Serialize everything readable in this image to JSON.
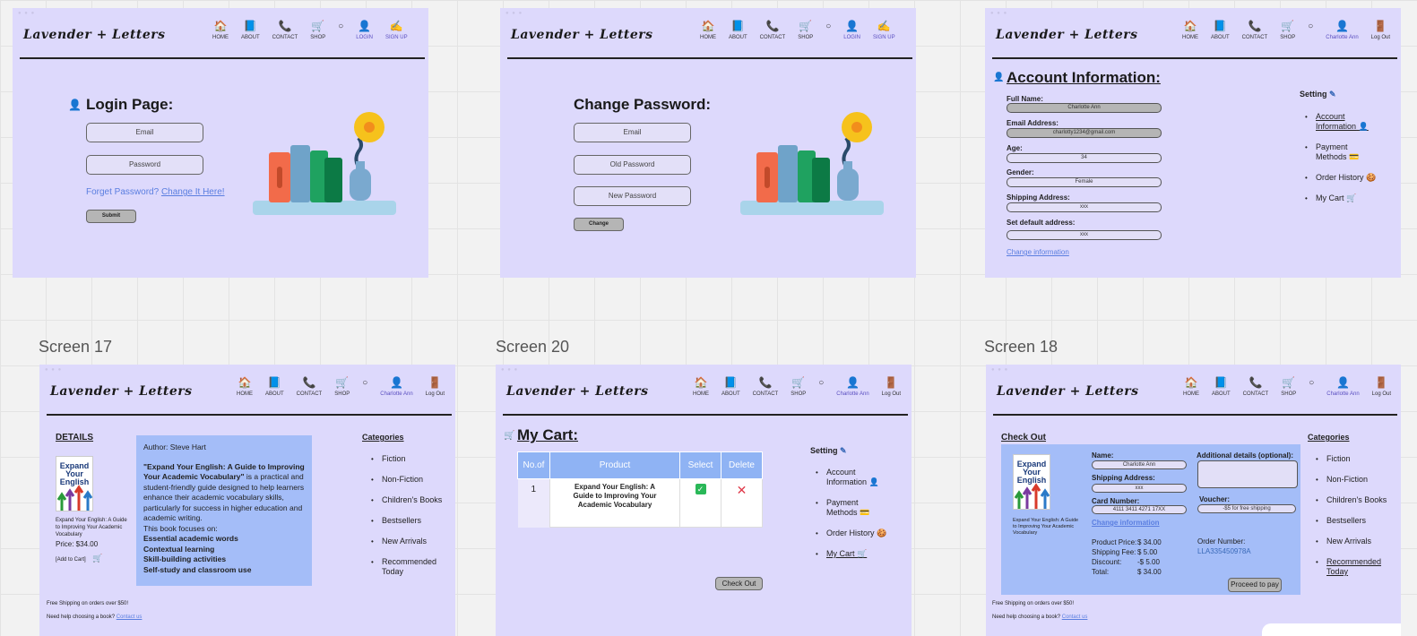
{
  "brand": "Lavender + Letters",
  "nav": {
    "home": "HOME",
    "about": "ABOUT",
    "contact": "CONTACT",
    "shop": "SHOP",
    "login": "LOGIN",
    "signup": "SIGN UP",
    "user": "Charlotte Ann",
    "logout": "Log Out"
  },
  "screen_labels": {
    "s17": "Screen 17",
    "s20": "Screen 20",
    "s18": "Screen 18"
  },
  "login": {
    "title": "Login Page:",
    "email": "Email",
    "password": "Password",
    "forget": "Forget Password?",
    "change_it": "Change It Here!",
    "submit": "Submit"
  },
  "change_pw": {
    "title": "Change Password:",
    "email": "Email",
    "old": "Old Password",
    "new": "New Password",
    "button": "Change"
  },
  "account": {
    "title": "Account Information:",
    "full_name_label": "Full Name:",
    "full_name": "Charlotte Ann",
    "email_label": "Email Address:",
    "email": "charlotty1234@gmail.com",
    "age_label": "Age:",
    "age": "34",
    "gender_label": "Gender:",
    "gender": "Female",
    "ship_label": "Shipping Address:",
    "ship": "xxx",
    "default_label": "Set default address:",
    "default": "xxx",
    "change_info": "Change information"
  },
  "settings": {
    "title": "Setting",
    "items": [
      "Account Information",
      "Payment Methods",
      "Order History",
      "My Cart"
    ]
  },
  "details": {
    "heading": "DETAILS",
    "author": "Author: Steve Hart",
    "desc_bold": "\"Expand Your English: A Guide to Improving Your Academic Vocabulary\"",
    "desc_rest": " is a practical and student-friendly guide designed to help learners enhance their academic vocabulary skills, particularly for success in higher education and academic writing.",
    "focus": "This book focuses on:",
    "points": [
      "Essential academic words",
      "Contextual learning",
      "Skill-building activities",
      "Self-study and classroom use"
    ],
    "book_name": "Expand Your English: A Guide to Improving Your Academic Vocabulary",
    "price": "Price: $34.00",
    "add": "[Add to Cart]",
    "cover_title": "Expand Your English",
    "shipping_note": "Free Shipping on orders over $50!",
    "help": "Need help choosing a book?",
    "contact": "Contact us"
  },
  "categories": {
    "title": "Categories",
    "items": [
      "Fiction",
      "Non-Fiction",
      "Children's Books",
      "Bestsellers",
      "New Arrivals",
      "Recommended Today"
    ]
  },
  "cart": {
    "title": "My Cart:",
    "headers": [
      "No.of",
      "Product",
      "Select",
      "Delete"
    ],
    "row": {
      "no": "1",
      "product": "Expand Your English: A Guide to Improving Your Academic Vocabulary"
    },
    "checkout": "Check Out"
  },
  "checkout": {
    "title": "Check Out",
    "name_label": "Name:",
    "name": "Charlotte Ann",
    "ship_label": "Shipping Address:",
    "ship": "xxx",
    "card_label": "Card Number:",
    "card": "4111 3411 4271 17XX",
    "change": "Change information",
    "addl_label": "Additional details (optional):",
    "voucher_label": "Voucher:",
    "voucher": "-$5 for free shipping",
    "price_rows": [
      [
        "Product Price:",
        "$ 34.00"
      ],
      [
        "Shipping Fee:",
        "$  5.00"
      ],
      [
        "Discount:",
        "-$  5.00"
      ],
      [
        "Total:",
        "$ 34.00"
      ]
    ],
    "order_label": "Order Number:",
    "order": "LLA335450978A",
    "pay": "Proceed to pay"
  }
}
